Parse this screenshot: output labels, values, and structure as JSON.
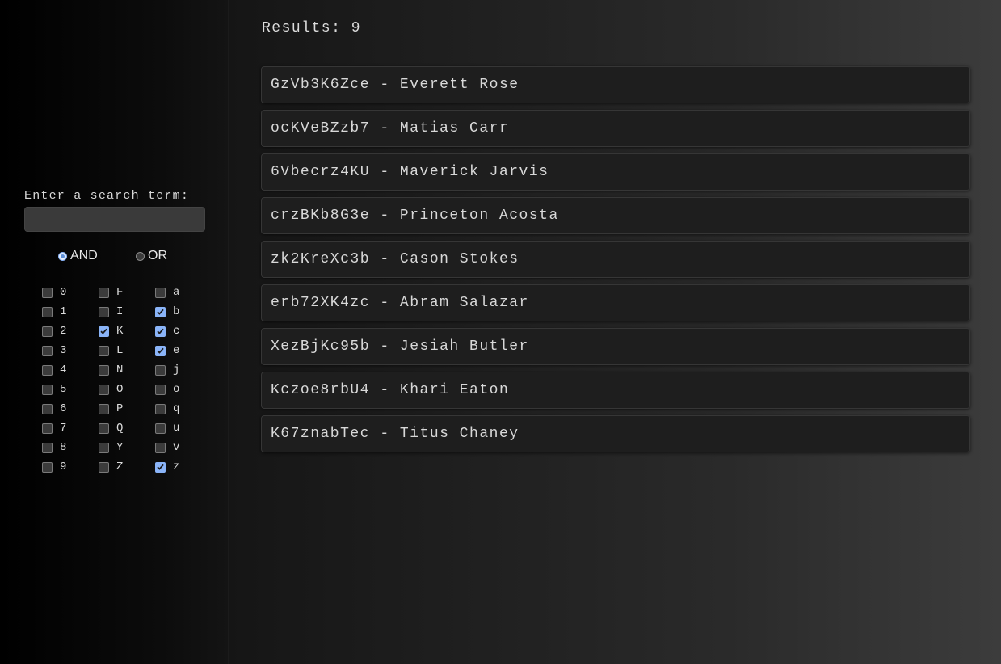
{
  "sidebar": {
    "search_label": "Enter a search term:",
    "search_value": "",
    "modes": [
      {
        "label": "AND",
        "checked": true
      },
      {
        "label": "OR",
        "checked": false
      }
    ],
    "filter_columns": [
      [
        {
          "label": "0",
          "checked": false
        },
        {
          "label": "1",
          "checked": false
        },
        {
          "label": "2",
          "checked": false
        },
        {
          "label": "3",
          "checked": false
        },
        {
          "label": "4",
          "checked": false
        },
        {
          "label": "5",
          "checked": false
        },
        {
          "label": "6",
          "checked": false
        },
        {
          "label": "7",
          "checked": false
        },
        {
          "label": "8",
          "checked": false
        },
        {
          "label": "9",
          "checked": false
        }
      ],
      [
        {
          "label": "F",
          "checked": false
        },
        {
          "label": "I",
          "checked": false
        },
        {
          "label": "K",
          "checked": true
        },
        {
          "label": "L",
          "checked": false
        },
        {
          "label": "N",
          "checked": false
        },
        {
          "label": "O",
          "checked": false
        },
        {
          "label": "P",
          "checked": false
        },
        {
          "label": "Q",
          "checked": false
        },
        {
          "label": "Y",
          "checked": false
        },
        {
          "label": "Z",
          "checked": false
        }
      ],
      [
        {
          "label": "a",
          "checked": false
        },
        {
          "label": "b",
          "checked": true
        },
        {
          "label": "c",
          "checked": true
        },
        {
          "label": "e",
          "checked": true
        },
        {
          "label": "j",
          "checked": false
        },
        {
          "label": "o",
          "checked": false
        },
        {
          "label": "q",
          "checked": false
        },
        {
          "label": "u",
          "checked": false
        },
        {
          "label": "v",
          "checked": false
        },
        {
          "label": "z",
          "checked": true
        }
      ]
    ]
  },
  "main": {
    "results_label": "Results: 9",
    "results": [
      "GzVb3K6Zce - Everett Rose",
      "ocKVeBZzb7 - Matias Carr",
      "6Vbecrz4KU - Maverick Jarvis",
      "crzBKb8G3e - Princeton Acosta",
      "zk2KreXc3b - Cason Stokes",
      "erb72XK4zc - Abram Salazar",
      "XezBjKc95b - Jesiah Butler",
      "Kczoe8rbU4 - Khari Eaton",
      "K67znabTec - Titus Chaney"
    ]
  },
  "icons": {
    "checked_box": "checkbox-checked-icon",
    "unchecked_box": "checkbox-unchecked-icon",
    "radio_on": "radio-selected-icon",
    "radio_off": "radio-unselected-icon"
  },
  "colors": {
    "accent": "#8ab4f8",
    "row_background": "#1e1e1e",
    "text": "#d8d8d8"
  }
}
